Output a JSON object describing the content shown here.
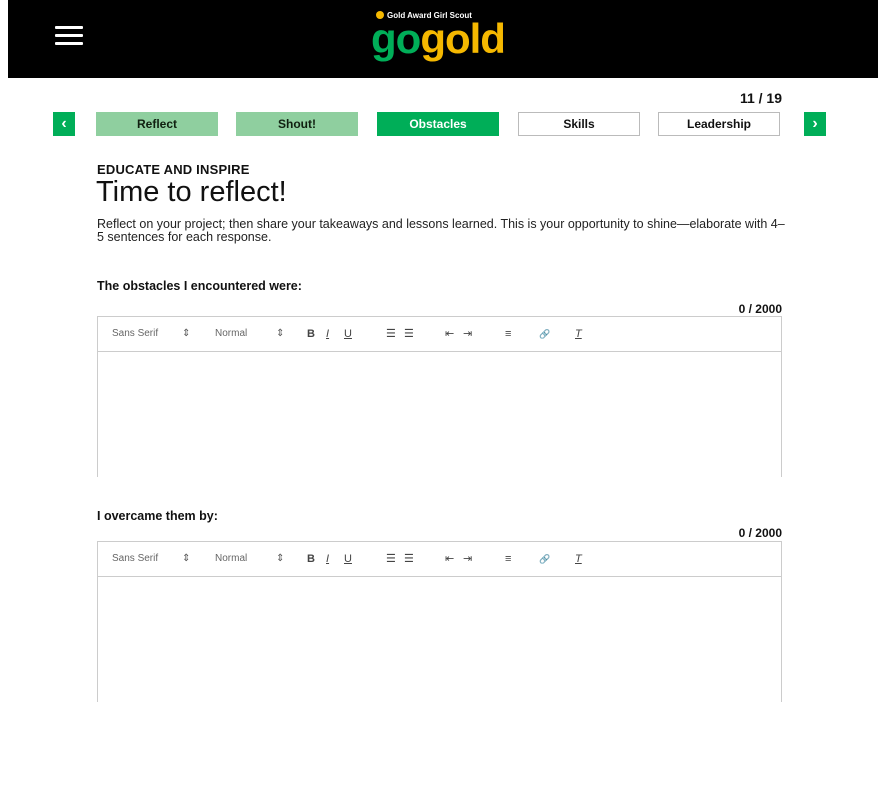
{
  "header": {
    "logo_tagline": "Gold Award Girl Scout",
    "logo_go": "go",
    "logo_gold": "gold"
  },
  "progress": {
    "page": "11 / 19"
  },
  "nav": {
    "prev_label": "‹",
    "next_label": "›",
    "tabs": [
      {
        "label": "Reflect",
        "state": "done"
      },
      {
        "label": "Shout!",
        "state": "done"
      },
      {
        "label": "Obstacles",
        "state": "active"
      },
      {
        "label": "Skills",
        "state": "todo"
      },
      {
        "label": "Leadership",
        "state": "todo"
      }
    ]
  },
  "intro": {
    "kicker": "EDUCATE AND INSPIRE",
    "title": "Time to reflect!",
    "lede": "Reflect on your project; then share your takeaways and lessons learned. This is your opportunity to shine—elaborate with 4–5 sentences for each response."
  },
  "toolbar": {
    "font_select": "Sans Serif",
    "size_select": "Normal",
    "caret": "⇕",
    "bold": "B",
    "italic": "I",
    "underline": "U",
    "ordered_list": "☰",
    "bullet_list": "☰",
    "outdent": "⇤",
    "indent": "⇥",
    "align": "≡",
    "link": "🔗",
    "clean": "T"
  },
  "questions": [
    {
      "label": "The obstacles I encountered were:",
      "count": "0 / 2000",
      "value": ""
    },
    {
      "label": "I overcame them by:",
      "count": "0 / 2000",
      "value": ""
    }
  ],
  "colors": {
    "brand_green": "#00ae58",
    "brand_gold": "#f5b800",
    "done_tab": "#8fcf9f"
  }
}
